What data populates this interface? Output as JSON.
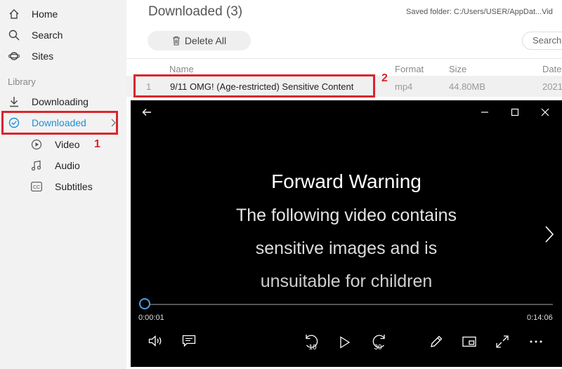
{
  "sidebar": {
    "nav": [
      {
        "label": "Home",
        "icon": "home-icon"
      },
      {
        "label": "Search",
        "icon": "search-icon"
      },
      {
        "label": "Sites",
        "icon": "planet-icon"
      }
    ],
    "section_label": "Library",
    "library": [
      {
        "label": "Downloading",
        "icon": "download-icon"
      },
      {
        "label": "Downloaded",
        "icon": "check-circle-icon"
      }
    ],
    "sub_items": [
      {
        "label": "Video",
        "icon": "play-circle-icon"
      },
      {
        "label": "Audio",
        "icon": "music-note-icon"
      },
      {
        "label": "Subtitles",
        "icon": "cc-icon"
      }
    ]
  },
  "main": {
    "title": "Downloaded (3)",
    "saved_folder": "Saved folder: C:/Users/USER/AppDat...Vid",
    "delete_all": "Delete All",
    "search_placeholder": "Search",
    "columns": [
      "Name",
      "Format",
      "Size",
      "Date"
    ],
    "row": {
      "index": "1",
      "name": "9/11 OMG! (Age-restricted) Sensitive Content",
      "format": "mp4",
      "size": "44.80MB",
      "date": "2021"
    }
  },
  "annotations": {
    "one": "1",
    "two": "2"
  },
  "player": {
    "warning_title": "Forward Warning",
    "warning_lines": [
      "The following video contains",
      "sensitive images and is",
      "unsuitable for children"
    ],
    "current_time": "0:00:01",
    "total_time": "0:14:06",
    "progress_fraction": 0.001,
    "skip_back_label": "10",
    "skip_forward_label": "30"
  },
  "colors": {
    "accent": "#1e8fd6",
    "annotation": "#d9262c",
    "player_bg": "#000000"
  }
}
